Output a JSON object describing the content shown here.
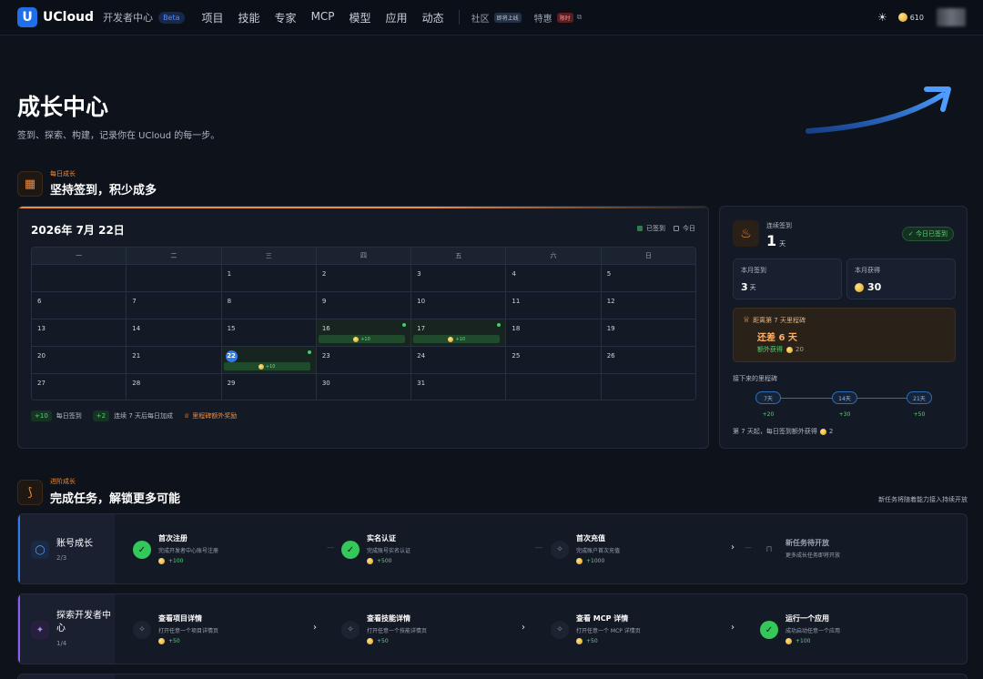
{
  "nav": {
    "logo_letter": "U",
    "brand": "UCloud",
    "dev_center": "开发者中心",
    "beta": "Beta",
    "items": [
      "项目",
      "技能",
      "专家",
      "MCP",
      "模型",
      "应用",
      "动态"
    ],
    "community": "社区",
    "community_tag": "即将上线",
    "deals": "特惠",
    "deals_tag": "限时",
    "coins": "610"
  },
  "hero": {
    "title": "成长中心",
    "subtitle": "签到、探索、构建，记录你在 UCloud 的每一步。"
  },
  "daily": {
    "kicker": "每日成长",
    "title": "坚持签到，积少成多"
  },
  "calendar": {
    "date_title": "2026年 7月 22日",
    "legend_signed": "已签到",
    "legend_today": "今日",
    "weekdays": [
      "一",
      "二",
      "三",
      "四",
      "五",
      "六",
      "日"
    ],
    "weeks": [
      [
        null,
        null,
        "1",
        "2",
        "3",
        "4",
        "5"
      ],
      [
        "6",
        "7",
        "8",
        "9",
        "10",
        "11",
        "12"
      ],
      [
        "13",
        "14",
        "15",
        "16",
        "17",
        "18",
        "19"
      ],
      [
        "20",
        "21",
        "22",
        "23",
        "24",
        "25",
        "26"
      ],
      [
        "27",
        "28",
        "29",
        "30",
        "31",
        null,
        null
      ]
    ],
    "earn_label": "+10",
    "footer": {
      "pill1": "+10",
      "text1": "每日签到",
      "pill2": "+2",
      "text2": "连续 7 天后每日加成",
      "text3": "里程碑额外奖励"
    }
  },
  "streak": {
    "label": "连续签到",
    "value": "1",
    "unit": "天",
    "today_badge": "✓ 今日已签到",
    "month_signed_label": "本月签到",
    "month_signed_value": "3",
    "month_signed_unit": "天",
    "month_earned_label": "本月获得",
    "month_earned_value": "30",
    "milestone_title": "距离第 7 天里程碑",
    "milestone_big": "还差 6 天",
    "milestone_bonus_label": "额外获得",
    "milestone_bonus_value": "20",
    "upcoming_label": "接下来的里程碑",
    "nodes": [
      {
        "label": "7天",
        "reward": "+20"
      },
      {
        "label": "14天",
        "reward": "+30"
      },
      {
        "label": "21天",
        "reward": "+50"
      }
    ],
    "note_pre": "第 7 天起，每日签到额外获得",
    "note_val": "2"
  },
  "advanced": {
    "kicker": "进阶成长",
    "title": "完成任务，解锁更多可能",
    "right_note": "新任务将随着能力接入持续开放"
  },
  "task_groups": [
    {
      "title": "账号成长",
      "count": "2/3",
      "items": [
        {
          "title": "首次注册",
          "desc": "完成开发者中心账号注册",
          "reward": "+100"
        },
        {
          "title": "实名认证",
          "desc": "完成账号实名认证",
          "reward": "+500"
        },
        {
          "title": "首次充值",
          "desc": "完成账户首次充值",
          "reward": "+1000"
        },
        {
          "title": "新任务待开放",
          "desc": "更多成长任务即将开放",
          "reward": ""
        }
      ]
    },
    {
      "title": "探索开发者中心",
      "count": "1/4",
      "items": [
        {
          "title": "查看项目详情",
          "desc": "打开任意一个项目详情页",
          "reward": "+50"
        },
        {
          "title": "查看技能详情",
          "desc": "打开任意一个技能详情页",
          "reward": "+50"
        },
        {
          "title": "查看 MCP 详情",
          "desc": "打开任意一个 MCP 详情页",
          "reward": "+50"
        },
        {
          "title": "运行一个应用",
          "desc": "成功启动任意一个应用",
          "reward": "+100"
        }
      ]
    }
  ]
}
